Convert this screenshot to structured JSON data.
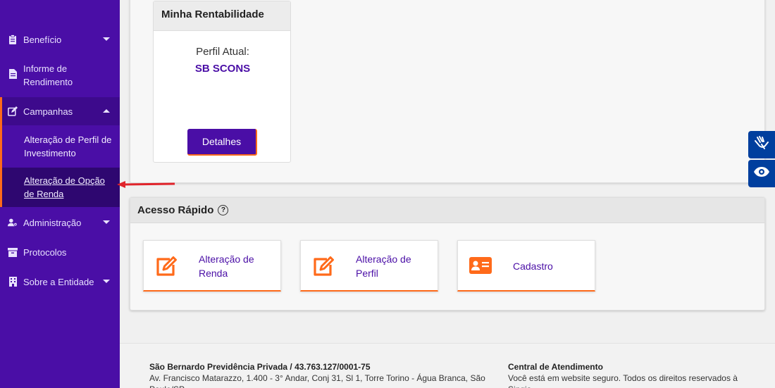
{
  "sidebar": {
    "items": [
      {
        "label": "Benefício",
        "icon": "clipboard-icon",
        "caret": "down"
      },
      {
        "label": "Informe de Rendimento",
        "icon": "document-icon"
      },
      {
        "label": "Campanhas",
        "icon": "edit-icon",
        "caret": "up"
      },
      {
        "label": "Administração",
        "icon": "user-cog-icon",
        "caret": "down"
      },
      {
        "label": "Protocolos",
        "icon": "archive-icon"
      },
      {
        "label": "Sobre a Entidade",
        "icon": "building-icon",
        "caret": "down"
      }
    ],
    "campanhas_sub": [
      {
        "label": "Alteração de Perfil de Investimento"
      },
      {
        "label": "Alteração de Opção de Renda",
        "active": true
      }
    ]
  },
  "rentabilidade": {
    "title": "Minha Rentabilidade",
    "perfil_label": "Perfil Atual:",
    "perfil_value": "SB SCONS",
    "details_button": "Detalhes"
  },
  "acesso_rapido": {
    "title": "Acesso Rápido",
    "help_glyph": "?",
    "cards": [
      {
        "label": "Alteração de Renda",
        "icon": "edit-icon"
      },
      {
        "label": "Alteração de Perfil",
        "icon": "edit-icon"
      },
      {
        "label": "Cadastro",
        "icon": "id-card-icon"
      }
    ]
  },
  "footer": {
    "company_title": "São Bernardo Previdência Privada / 43.763.127/0001-75",
    "address": "Av. Francisco Matarazzo, 1.400 - 3° Andar, Conj 31, Sl 1, Torre Torino - Água Branca, São Paulo/SP",
    "central_title": "Central de Atendimento",
    "central_text": "Você está em website seguro. Todos os direitos reservados à Sinqia"
  },
  "colors": {
    "sidebar": "#4a0ea6",
    "accent": "#ff6a1a",
    "accessibility": "#003f9e"
  }
}
